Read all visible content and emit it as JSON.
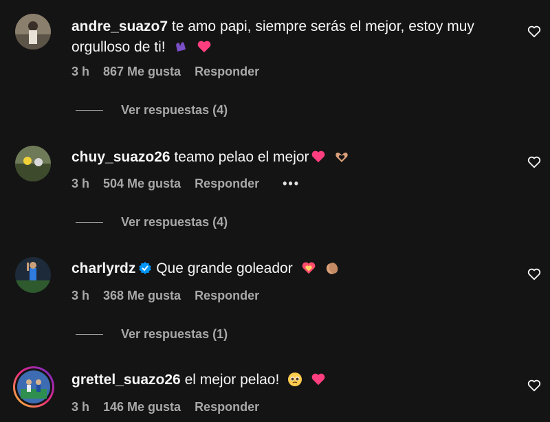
{
  "comments": [
    {
      "username": "andre_suazo7",
      "text": "te amo papi, siempre serás el mejor, estoy muy orgulloso de ti!",
      "emojis": [
        "purple-hand-heart-emoji",
        "pink-heart-emoji"
      ],
      "time": "3 h",
      "likes": "867 Me gusta",
      "reply_label": "Responder",
      "view_replies": "Ver respuestas (4)",
      "verified": false
    },
    {
      "username": "chuy_suazo26",
      "text": "teamo pelao el mejor",
      "emojis": [
        "pink-heart-emoji",
        "heart-hands-emoji"
      ],
      "time": "3 h",
      "likes": "504 Me gusta",
      "reply_label": "Responder",
      "more": "•••",
      "view_replies": "Ver respuestas (4)",
      "verified": false
    },
    {
      "username": "charlyrdz",
      "text": "Que grande goleador",
      "emojis": [
        "heart-on-fire-emoji",
        "clapping-hands-emoji"
      ],
      "time": "3 h",
      "likes": "368 Me gusta",
      "reply_label": "Responder",
      "view_replies": "Ver respuestas (1)",
      "verified": true
    },
    {
      "username": "grettel_suazo26",
      "text": "el mejor pelao!",
      "emojis": [
        "pleading-face-emoji",
        "pink-heart-emoji"
      ],
      "time": "3 h",
      "likes": "146 Me gusta",
      "reply_label": "Responder",
      "verified": false,
      "story_ring": true
    }
  ],
  "colors": {
    "background": "#141414",
    "text": "#f5f5f5",
    "muted": "#a8a8a8",
    "verified": "#0095f6",
    "heart": "#ff3366"
  }
}
